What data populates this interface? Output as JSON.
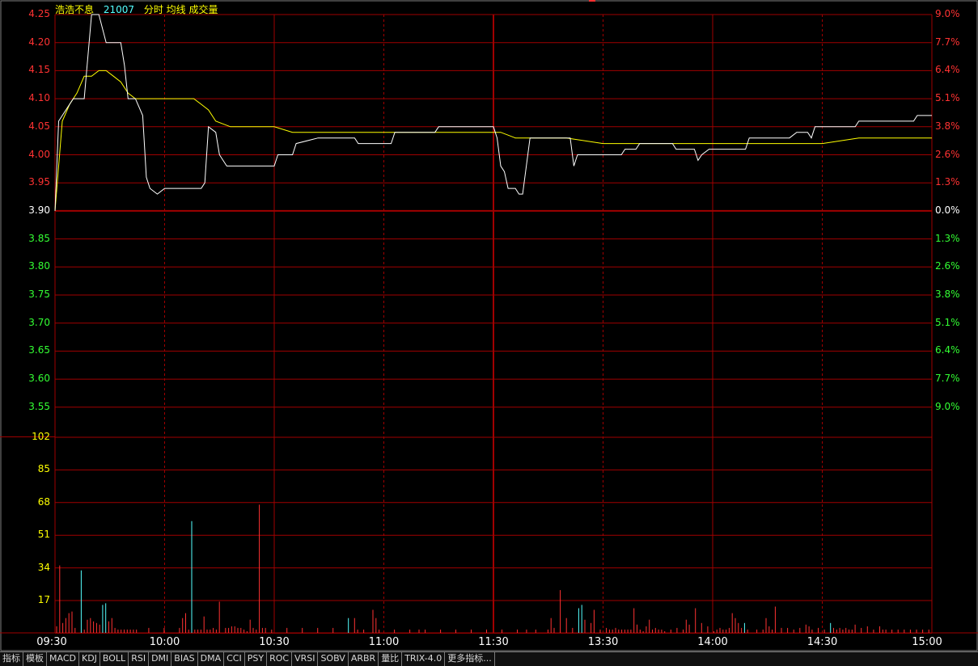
{
  "header": {
    "stock_name": "浩浩不息",
    "stock_code": "21007",
    "chart_labels": "分时 均线 成交量"
  },
  "colors": {
    "grid": "#a00000",
    "up": "#ff3232",
    "down": "#33ff33",
    "neutral": "#ffffff",
    "label_yellow": "#ffff00",
    "price_line": "#ffffff",
    "avg_line": "#ffff00",
    "volume_up": "#ff3232",
    "volume_down": "#54ffff"
  },
  "price_axis": {
    "left_labels": [
      "4.25",
      "4.20",
      "4.15",
      "4.10",
      "4.05",
      "4.00",
      "3.95",
      "3.90",
      "3.85",
      "3.80",
      "3.75",
      "3.70",
      "3.65",
      "3.60",
      "3.55"
    ],
    "right_labels": [
      "9.0%",
      "7.7%",
      "6.4%",
      "5.1%",
      "3.8%",
      "2.6%",
      "1.3%",
      "0.0%",
      "1.3%",
      "2.6%",
      "3.8%",
      "5.1%",
      "6.4%",
      "7.7%",
      "9.0%"
    ]
  },
  "volume_axis": {
    "labels": [
      "102",
      "85",
      "68",
      "51",
      "34",
      "17"
    ]
  },
  "time_axis": {
    "labels": [
      "09:30",
      "10:00",
      "10:30",
      "11:00",
      "11:30",
      "13:30",
      "14:00",
      "14:30",
      "15:00"
    ]
  },
  "tabs": [
    "指标",
    "模板",
    "MACD",
    "KDJ",
    "BOLL",
    "RSI",
    "DMI",
    "BIAS",
    "DMA",
    "CCI",
    "PSY",
    "ROC",
    "VRSI",
    "SOBV",
    "ARBR",
    "量比",
    "TRIX-4.0",
    "更多指标..."
  ],
  "chart_data": {
    "type": "line",
    "title": "",
    "x_range": [
      0,
      240
    ],
    "ylim": [
      3.55,
      4.25
    ],
    "pre_close": 3.9,
    "price": [
      [
        0,
        3.9
      ],
      [
        1,
        4.06
      ],
      [
        3,
        4.08
      ],
      [
        5,
        4.1
      ],
      [
        8,
        4.1
      ],
      [
        10,
        4.3
      ],
      [
        12,
        4.3
      ],
      [
        14,
        4.2
      ],
      [
        18,
        4.2
      ],
      [
        19,
        4.16
      ],
      [
        20,
        4.1
      ],
      [
        22,
        4.1
      ],
      [
        24,
        4.07
      ],
      [
        25,
        3.96
      ],
      [
        26,
        3.94
      ],
      [
        28,
        3.93
      ],
      [
        30,
        3.94
      ],
      [
        40,
        3.94
      ],
      [
        41,
        3.95
      ],
      [
        42,
        4.05
      ],
      [
        44,
        4.04
      ],
      [
        45,
        4.0
      ],
      [
        47,
        3.98
      ],
      [
        60,
        3.98
      ],
      [
        61,
        4.0
      ],
      [
        65,
        4.0
      ],
      [
        66,
        4.02
      ],
      [
        72,
        4.03
      ],
      [
        82,
        4.03
      ],
      [
        83,
        4.02
      ],
      [
        92,
        4.02
      ],
      [
        93,
        4.04
      ],
      [
        104,
        4.04
      ],
      [
        105,
        4.05
      ],
      [
        119,
        4.05
      ],
      [
        120,
        4.05
      ],
      [
        121,
        4.03
      ],
      [
        122,
        3.98
      ],
      [
        123,
        3.97
      ],
      [
        124,
        3.94
      ],
      [
        126,
        3.94
      ],
      [
        127,
        3.93
      ],
      [
        128,
        3.93
      ],
      [
        130,
        4.03
      ],
      [
        141,
        4.03
      ],
      [
        142,
        3.98
      ],
      [
        143,
        4.0
      ],
      [
        146,
        4.0
      ],
      [
        147,
        4.0
      ],
      [
        150,
        4.0
      ],
      [
        155,
        4.0
      ],
      [
        156,
        4.01
      ],
      [
        159,
        4.01
      ],
      [
        160,
        4.02
      ],
      [
        166,
        4.02
      ],
      [
        167,
        4.02
      ],
      [
        169,
        4.02
      ],
      [
        170,
        4.01
      ],
      [
        175,
        4.01
      ],
      [
        176,
        3.99
      ],
      [
        177,
        4.0
      ],
      [
        179,
        4.01
      ],
      [
        189,
        4.01
      ],
      [
        190,
        4.03
      ],
      [
        200,
        4.03
      ],
      [
        201,
        4.03
      ],
      [
        203,
        4.04
      ],
      [
        206,
        4.04
      ],
      [
        207,
        4.03
      ],
      [
        208,
        4.05
      ],
      [
        211,
        4.05
      ],
      [
        219,
        4.05
      ],
      [
        220,
        4.06
      ],
      [
        232,
        4.06
      ],
      [
        233,
        4.06
      ],
      [
        235,
        4.06
      ],
      [
        236,
        4.07
      ],
      [
        240,
        4.07
      ]
    ],
    "avg": [
      [
        0,
        3.9
      ],
      [
        2,
        4.06
      ],
      [
        4,
        4.09
      ],
      [
        6,
        4.11
      ],
      [
        8,
        4.14
      ],
      [
        10,
        4.14
      ],
      [
        12,
        4.15
      ],
      [
        14,
        4.15
      ],
      [
        16,
        4.14
      ],
      [
        18,
        4.13
      ],
      [
        20,
        4.11
      ],
      [
        22,
        4.1
      ],
      [
        26,
        4.1
      ],
      [
        30,
        4.1
      ],
      [
        34,
        4.1
      ],
      [
        38,
        4.1
      ],
      [
        40,
        4.09
      ],
      [
        42,
        4.08
      ],
      [
        44,
        4.06
      ],
      [
        48,
        4.05
      ],
      [
        55,
        4.05
      ],
      [
        60,
        4.05
      ],
      [
        65,
        4.04
      ],
      [
        70,
        4.04
      ],
      [
        80,
        4.04
      ],
      [
        100,
        4.04
      ],
      [
        120,
        4.04
      ],
      [
        122,
        4.04
      ],
      [
        126,
        4.03
      ],
      [
        130,
        4.03
      ],
      [
        140,
        4.03
      ],
      [
        150,
        4.02
      ],
      [
        160,
        4.02
      ],
      [
        180,
        4.02
      ],
      [
        190,
        4.02
      ],
      [
        200,
        4.02
      ],
      [
        210,
        4.02
      ],
      [
        220,
        4.03
      ],
      [
        230,
        4.03
      ],
      [
        240,
        4.03
      ]
    ],
    "vol_max": 119,
    "volume": [
      [
        0,
        4,
        1
      ],
      [
        1,
        41,
        1
      ],
      [
        2,
        6,
        1
      ],
      [
        3,
        9,
        1
      ],
      [
        4,
        12,
        1
      ],
      [
        5,
        13,
        1
      ],
      [
        6,
        3,
        1
      ],
      [
        8,
        38,
        -1
      ],
      [
        9,
        2,
        1
      ],
      [
        10,
        8,
        1
      ],
      [
        11,
        9,
        1
      ],
      [
        12,
        7,
        1
      ],
      [
        13,
        6,
        1
      ],
      [
        14,
        5,
        1
      ],
      [
        15,
        17,
        -1
      ],
      [
        16,
        18,
        -1
      ],
      [
        17,
        7,
        1
      ],
      [
        18,
        9,
        1
      ],
      [
        19,
        3,
        1
      ],
      [
        20,
        2,
        1
      ],
      [
        21,
        2,
        1
      ],
      [
        22,
        2,
        1
      ],
      [
        23,
        2,
        1
      ],
      [
        24,
        2,
        1
      ],
      [
        25,
        2,
        1
      ],
      [
        26,
        2,
        1
      ],
      [
        30,
        3,
        1
      ],
      [
        35,
        3,
        1
      ],
      [
        40,
        3,
        1
      ],
      [
        41,
        9,
        1
      ],
      [
        42,
        12,
        1
      ],
      [
        43,
        2,
        1
      ],
      [
        44,
        68,
        -1
      ],
      [
        45,
        2,
        1
      ],
      [
        46,
        2,
        1
      ],
      [
        47,
        2,
        1
      ],
      [
        48,
        10,
        1
      ],
      [
        49,
        2,
        1
      ],
      [
        50,
        2,
        1
      ],
      [
        51,
        3,
        1
      ],
      [
        52,
        2,
        1
      ],
      [
        53,
        19,
        1
      ],
      [
        55,
        3,
        1
      ],
      [
        56,
        3,
        1
      ],
      [
        57,
        4,
        1
      ],
      [
        58,
        4,
        1
      ],
      [
        59,
        3,
        1
      ],
      [
        60,
        3,
        1
      ],
      [
        61,
        2,
        1
      ],
      [
        62,
        1,
        1
      ],
      [
        63,
        8,
        1
      ],
      [
        64,
        3,
        1
      ],
      [
        65,
        2,
        1
      ],
      [
        66,
        78,
        1
      ],
      [
        67,
        3,
        1
      ],
      [
        68,
        3,
        1
      ],
      [
        70,
        2,
        1
      ],
      [
        75,
        3,
        1
      ],
      [
        80,
        3,
        1
      ],
      [
        85,
        3,
        1
      ],
      [
        90,
        3,
        1
      ],
      [
        95,
        9,
        -1
      ],
      [
        97,
        9,
        1
      ],
      [
        98,
        2,
        1
      ],
      [
        100,
        2,
        1
      ],
      [
        103,
        14,
        1
      ],
      [
        104,
        9,
        1
      ],
      [
        105,
        2,
        1
      ],
      [
        110,
        2,
        1
      ],
      [
        115,
        2,
        1
      ],
      [
        118,
        2,
        1
      ],
      [
        120,
        2,
        1
      ],
      [
        125,
        2,
        1
      ],
      [
        130,
        2,
        1
      ],
      [
        135,
        2,
        1
      ],
      [
        140,
        2,
        1
      ],
      [
        145,
        2,
        1
      ],
      [
        150,
        2,
        1
      ],
      [
        153,
        2,
        1
      ],
      [
        156,
        2,
        1
      ],
      [
        160,
        2,
        1
      ],
      [
        161,
        9,
        1
      ],
      [
        162,
        3,
        1
      ],
      [
        164,
        26,
        1
      ],
      [
        166,
        9,
        1
      ],
      [
        168,
        3,
        1
      ],
      [
        170,
        15,
        -1
      ],
      [
        171,
        17,
        -1
      ],
      [
        172,
        8,
        1
      ],
      [
        174,
        6,
        1
      ],
      [
        175,
        14,
        1
      ],
      [
        177,
        2,
        1
      ],
      [
        179,
        3,
        1
      ],
      [
        180,
        2,
        1
      ],
      [
        181,
        2,
        1
      ],
      [
        182,
        3,
        1
      ],
      [
        183,
        2,
        1
      ],
      [
        184,
        2,
        1
      ],
      [
        185,
        2,
        1
      ],
      [
        186,
        2,
        1
      ],
      [
        187,
        2,
        1
      ],
      [
        188,
        15,
        1
      ],
      [
        189,
        5,
        1
      ],
      [
        190,
        2,
        1
      ],
      [
        191,
        1,
        1
      ],
      [
        192,
        4,
        1
      ],
      [
        193,
        8,
        1
      ],
      [
        194,
        2,
        1
      ],
      [
        195,
        3,
        1
      ],
      [
        196,
        2,
        1
      ],
      [
        197,
        2,
        1
      ],
      [
        198,
        1,
        1
      ],
      [
        200,
        2,
        1
      ],
      [
        202,
        3,
        1
      ],
      [
        204,
        2,
        1
      ],
      [
        205,
        8,
        1
      ],
      [
        206,
        5,
        1
      ],
      [
        208,
        15,
        1
      ],
      [
        210,
        6,
        1
      ],
      [
        212,
        4,
        1
      ],
      [
        214,
        1,
        1
      ],
      [
        215,
        2,
        1
      ],
      [
        216,
        3,
        1
      ],
      [
        217,
        2,
        1
      ],
      [
        218,
        2,
        1
      ],
      [
        219,
        3,
        1
      ],
      [
        220,
        12,
        1
      ],
      [
        221,
        9,
        1
      ],
      [
        222,
        6,
        1
      ],
      [
        223,
        3,
        1
      ],
      [
        224,
        6,
        -1
      ],
      [
        225,
        2,
        1
      ],
      [
        228,
        2,
        1
      ],
      [
        230,
        2,
        1
      ],
      [
        231,
        9,
        1
      ],
      [
        232,
        4,
        1
      ],
      [
        233,
        2,
        1
      ],
      [
        234,
        16,
        1
      ],
      [
        236,
        3,
        1
      ],
      [
        238,
        3,
        1
      ],
      [
        240,
        2,
        1
      ],
      [
        242,
        3,
        1
      ],
      [
        244,
        5,
        1
      ],
      [
        245,
        4,
        1
      ],
      [
        246,
        2,
        1
      ],
      [
        248,
        3,
        1
      ],
      [
        250,
        2,
        1
      ],
      [
        252,
        6,
        -1
      ],
      [
        253,
        3,
        1
      ],
      [
        254,
        2,
        1
      ],
      [
        255,
        3,
        1
      ],
      [
        256,
        2,
        1
      ],
      [
        257,
        3,
        1
      ],
      [
        258,
        2,
        1
      ],
      [
        259,
        2,
        1
      ],
      [
        260,
        5,
        1
      ],
      [
        262,
        3,
        1
      ],
      [
        264,
        4,
        1
      ],
      [
        266,
        2,
        1
      ],
      [
        268,
        4,
        1
      ],
      [
        269,
        2,
        1
      ],
      [
        270,
        2,
        1
      ],
      [
        272,
        2,
        1
      ],
      [
        274,
        2,
        1
      ],
      [
        276,
        2,
        1
      ],
      [
        278,
        2,
        1
      ],
      [
        280,
        2,
        1
      ],
      [
        282,
        2,
        1
      ],
      [
        284,
        2,
        1
      ]
    ]
  }
}
